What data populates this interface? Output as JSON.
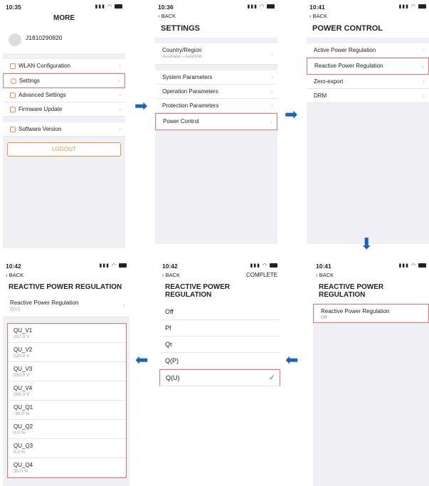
{
  "screens": {
    "more": {
      "time": "10:35",
      "title": "MORE",
      "user": "J1810290820",
      "menu": [
        {
          "label": "WLAN Configuration"
        },
        {
          "label": "Settings"
        },
        {
          "label": "Advanced Settings"
        },
        {
          "label": "Firmware Update"
        }
      ],
      "software": "Software Version",
      "logout": "LOGOUT"
    },
    "settings": {
      "time": "10:36",
      "back": "BACK",
      "title": "SETTINGS",
      "country_label": "Country/Region",
      "country_value": "Australia – AusGrid",
      "items": [
        "System Parameters",
        "Operation Parameters",
        "Protection Parameters",
        "Power Control"
      ]
    },
    "power": {
      "time": "10:41",
      "back": "BACK",
      "title": "POWER CONTROL",
      "items": [
        "Active Power Regulation",
        "Reactive Power Regulation",
        "Zero-export",
        "DRM"
      ]
    },
    "reactive_off": {
      "time": "10:41",
      "back": "BACK",
      "title": "REACTIVE POWER REGULATION",
      "label": "Reactive Power Regulation",
      "value": "Off"
    },
    "choose": {
      "time": "10:42",
      "back": "BACK",
      "complete": "COMPLETE",
      "title": "REACTIVE POWER REGULATION",
      "options": [
        "Off",
        "Pf",
        "Qt",
        "Q(P)",
        "Q(U)"
      ]
    },
    "reactive_qu": {
      "time": "10:42",
      "back": "BACK",
      "title": "REACTIVE POWER REGULATION",
      "label": "Reactive Power Regulation",
      "value": "Q(U)",
      "params": [
        {
          "name": "QU_V1",
          "value": "207.0 V"
        },
        {
          "name": "QU_V2",
          "value": "220.0 V"
        },
        {
          "name": "QU_V3",
          "value": "250.0 V"
        },
        {
          "name": "QU_V4",
          "value": "265.0 V"
        },
        {
          "name": "QU_Q1",
          "value": "-30.0 %"
        },
        {
          "name": "QU_Q2",
          "value": "0.0 %"
        },
        {
          "name": "QU_Q3",
          "value": "0.0 %"
        },
        {
          "name": "QU_Q4",
          "value": "30.0 %"
        }
      ]
    }
  },
  "arrow_color": "#1565c0",
  "highlight_color": "#e87070"
}
